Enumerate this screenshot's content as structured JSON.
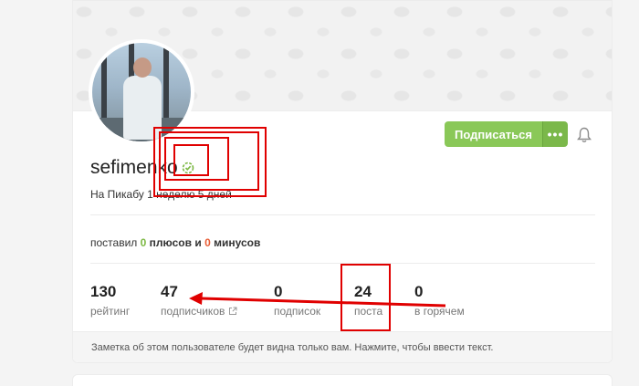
{
  "profile": {
    "username": "sefimenko",
    "member_since": "На Пикабу 1 неделю 5 дней"
  },
  "actions": {
    "subscribe_label": "Подписаться",
    "more_label": "•••"
  },
  "votes": {
    "prefix": "поставил",
    "plus_count": "0",
    "plus_label": "плюсов",
    "conjunction": "и",
    "minus_count": "0",
    "minus_label": "минусов"
  },
  "stats": [
    {
      "value": "130",
      "label": "рейтинг"
    },
    {
      "value": "47",
      "label": "подписчиков"
    },
    {
      "value": "0",
      "label": "подписок"
    },
    {
      "value": "24",
      "label": "поста"
    },
    {
      "value": "0",
      "label": "в горячем"
    }
  ],
  "note": "Заметка об этом пользователе будет видна только вам. Нажмите, чтобы ввести текст.",
  "colors": {
    "accent_green": "#8ac858",
    "plus_green": "#7cb843",
    "minus_orange": "#e85d35",
    "annotation_red": "#e00000"
  }
}
